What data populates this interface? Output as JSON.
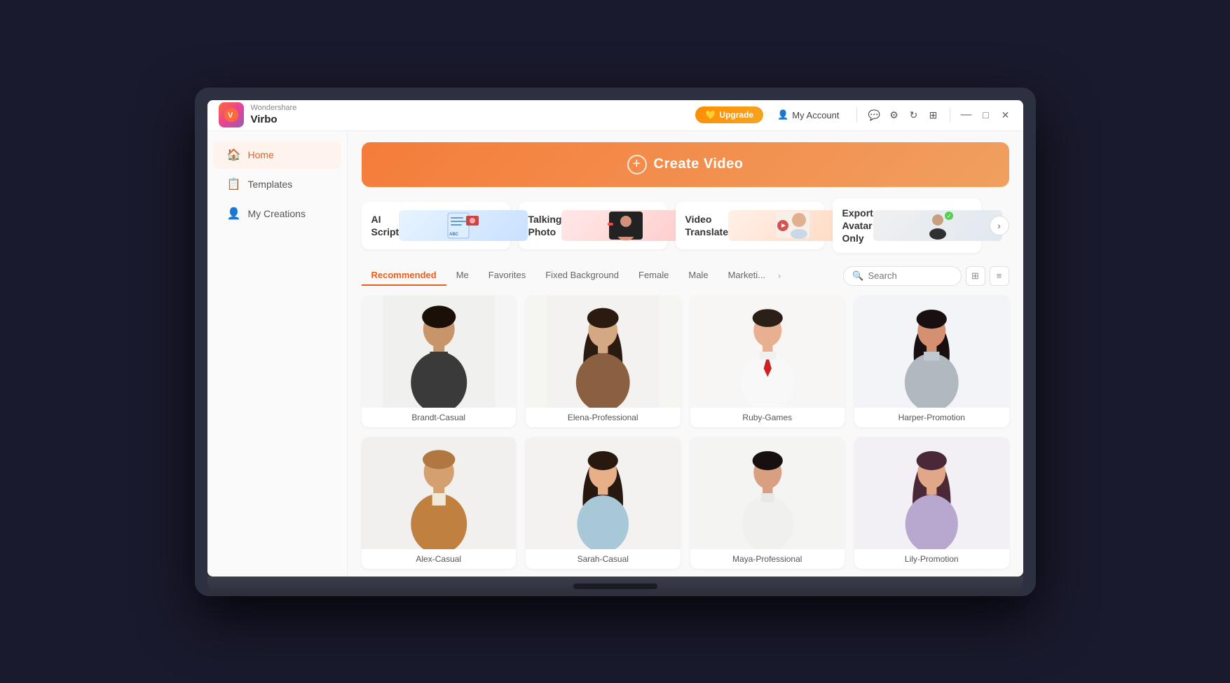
{
  "app": {
    "brand": "Wondershare",
    "title": "Virbo",
    "logo_char": "V"
  },
  "titlebar": {
    "upgrade_label": "Upgrade",
    "my_account_label": "My Account"
  },
  "sidebar": {
    "items": [
      {
        "id": "home",
        "label": "Home",
        "icon": "🏠",
        "active": true
      },
      {
        "id": "templates",
        "label": "Templates",
        "icon": "📋",
        "active": false
      },
      {
        "id": "my-creations",
        "label": "My Creations",
        "icon": "👤",
        "active": false
      }
    ]
  },
  "content": {
    "create_video_label": "Create Video",
    "feature_cards": [
      {
        "id": "ai-script",
        "label": "AI Script",
        "thumb_type": "ai-script"
      },
      {
        "id": "talking-photo",
        "label": "Talking Photo",
        "thumb_type": "talking-photo"
      },
      {
        "id": "video-translate",
        "label": "Video Translate",
        "thumb_type": "video-translate"
      },
      {
        "id": "export-avatar",
        "label": "Export Avatar Only",
        "thumb_type": "export-avatar"
      }
    ],
    "filter_tabs": [
      {
        "id": "recommended",
        "label": "Recommended",
        "active": true
      },
      {
        "id": "me",
        "label": "Me",
        "active": false
      },
      {
        "id": "favorites",
        "label": "Favorites",
        "active": false
      },
      {
        "id": "fixed-bg",
        "label": "Fixed Background",
        "active": false
      },
      {
        "id": "female",
        "label": "Female",
        "active": false
      },
      {
        "id": "male",
        "label": "Male",
        "active": false
      },
      {
        "id": "marketing",
        "label": "Marketi...",
        "active": false
      }
    ],
    "search_placeholder": "Search",
    "avatars_row1": [
      {
        "id": "brandt",
        "name": "Brandt-Casual",
        "bg": "#f0f0ee",
        "skin": "#c8956a",
        "hair": "#2a1a0a",
        "outfit": "#3a3a3a"
      },
      {
        "id": "elena",
        "name": "Elena-Professional",
        "bg": "#f4f2f0",
        "skin": "#d4a882",
        "hair": "#3a2820",
        "outfit": "#8b6040"
      },
      {
        "id": "ruby",
        "name": "Ruby-Games",
        "bg": "#f6f4f2",
        "skin": "#e8b090",
        "hair": "#2a2018",
        "outfit": "#f0f0f0"
      },
      {
        "id": "harper",
        "name": "Harper-Promotion",
        "bg": "#f0f2f4",
        "skin": "#d49070",
        "hair": "#1a1010",
        "outfit": "#b8c0c8"
      }
    ],
    "avatars_row2": [
      {
        "id": "alex",
        "name": "Alex-Casual",
        "bg": "#f2f0ee",
        "skin": "#d4a070",
        "hair": "#a07040",
        "outfit": "#c08040"
      },
      {
        "id": "sarah",
        "name": "Sarah-Casual",
        "bg": "#f4f2f0",
        "skin": "#e8b088",
        "hair": "#281810",
        "outfit": "#a8c8d8"
      },
      {
        "id": "maya",
        "name": "Maya-Professional",
        "bg": "#f4f4f2",
        "skin": "#d8a080",
        "hair": "#181010",
        "outfit": "#f0f0ee"
      },
      {
        "id": "lily",
        "name": "Lily-Promotion",
        "bg": "#f2f0f4",
        "skin": "#e0a888",
        "hair": "#4a2838",
        "outfit": "#b8a8d0"
      }
    ]
  }
}
